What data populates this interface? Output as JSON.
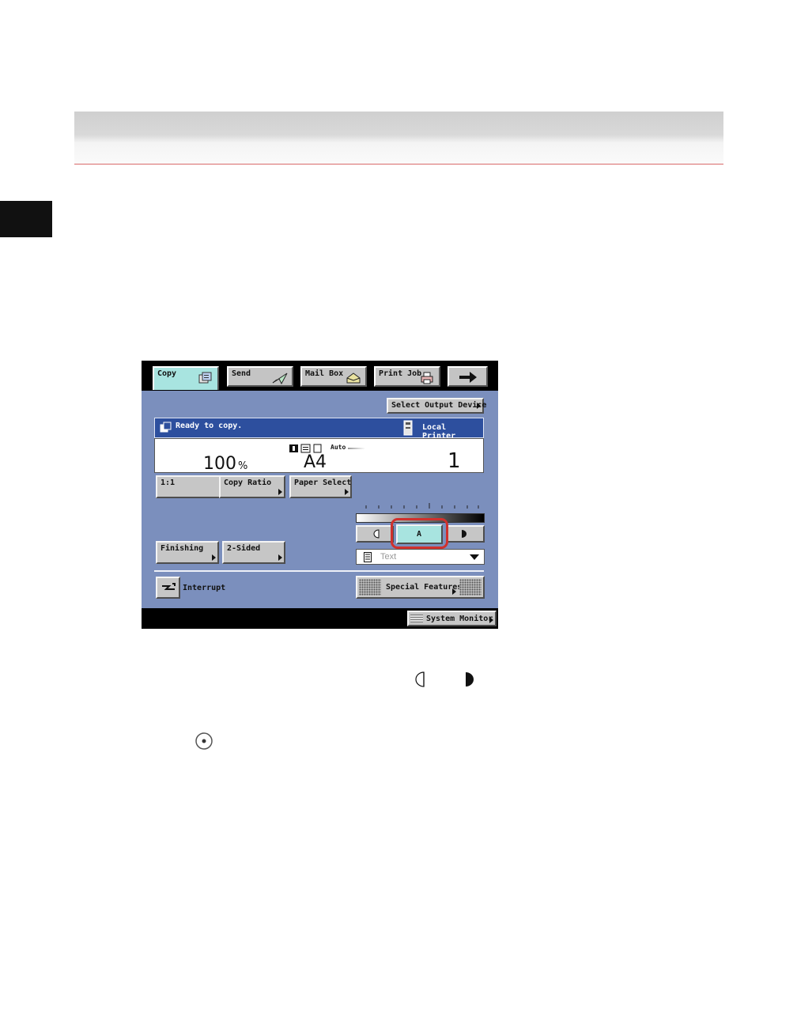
{
  "screen": {
    "tabs": [
      {
        "label": "Copy",
        "icon": "copy-icon",
        "active": true
      },
      {
        "label": "Send",
        "icon": "send-icon"
      },
      {
        "label": "Mail Box",
        "icon": "mailbox-icon"
      },
      {
        "label": "Print Job",
        "icon": "printer-icon"
      }
    ],
    "next_icon": "arrow-right-icon",
    "select_output_device": "Select Output Device",
    "status": {
      "text": "Ready to copy.",
      "device": "Local Printer"
    },
    "info": {
      "ratio_value": "100",
      "ratio_unit": "%",
      "paper_mode": "Auto",
      "paper_size": "A4",
      "copies": "1"
    },
    "buttons": {
      "one_to_one": "1:1",
      "copy_ratio": "Copy Ratio",
      "paper_select": "Paper Select",
      "finishing": "Finishing",
      "two_sided": "2-Sided",
      "density_auto": "A",
      "image_type": "Text",
      "interrupt": "Interrupt",
      "special_features": "Special Features",
      "system_monitor": "System Monitor"
    },
    "colors": {
      "screen_bg": "#7b8fbd",
      "status_bg": "#2d4f9e",
      "active_tab": "#a8e4e0",
      "highlight": "#d0312d"
    }
  },
  "inline_icons": [
    "lighter-icon",
    "darker-icon",
    "ok-key-icon"
  ]
}
